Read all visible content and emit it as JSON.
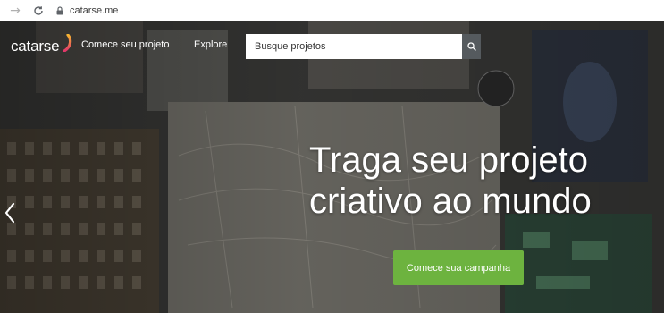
{
  "browser": {
    "url": "catarse.me",
    "back_icon": "arrow-left-icon",
    "reload_icon": "reload-icon",
    "lock_icon": "lock-icon"
  },
  "header": {
    "logo_text": "catarse",
    "nav": {
      "start_project": "Comece seu projeto",
      "explore": "Explore"
    },
    "search": {
      "placeholder": "Busque projetos",
      "icon": "search-icon"
    }
  },
  "hero": {
    "headline_line1": "Traga seu projeto",
    "headline_line2": "criativo ao mundo",
    "cta_label": "Comece sua campanha",
    "prev_icon": "chevron-left-icon"
  },
  "colors": {
    "cta": "#6db33f",
    "search_button": "#555a5e",
    "logo_gradient": [
      "#f7b531",
      "#e2366a"
    ]
  }
}
